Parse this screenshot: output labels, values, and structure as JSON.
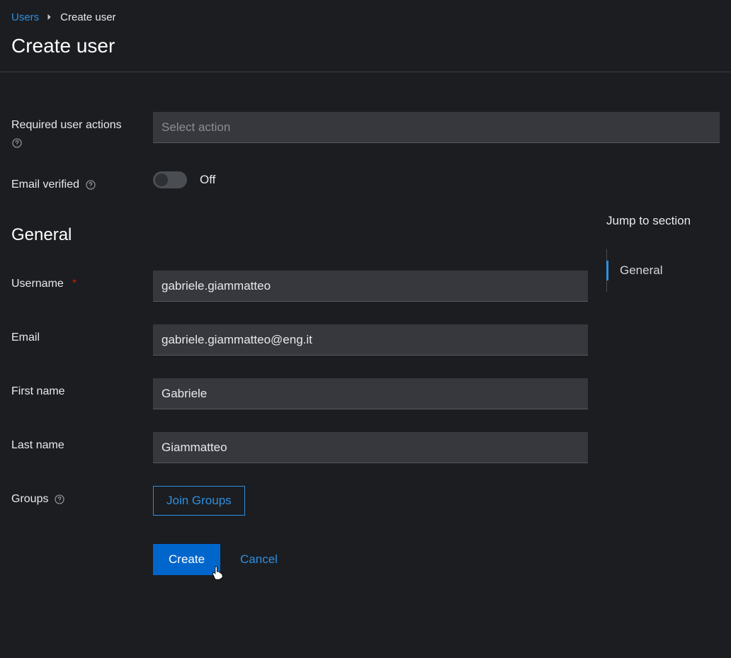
{
  "breadcrumb": {
    "users": "Users",
    "current": "Create user"
  },
  "page": {
    "title": "Create user"
  },
  "form": {
    "required_actions": {
      "label": "Required user actions",
      "placeholder": "Select action"
    },
    "email_verified": {
      "label": "Email verified",
      "state_label": "Off",
      "value": false
    },
    "section_title": "General",
    "username": {
      "label": "Username",
      "value": "gabriele.giammatteo",
      "required": true
    },
    "email": {
      "label": "Email",
      "value": "gabriele.giammatteo@eng.it"
    },
    "first_name": {
      "label": "First name",
      "value": "Gabriele"
    },
    "last_name": {
      "label": "Last name",
      "value": "Giammatteo"
    },
    "groups": {
      "label": "Groups",
      "button": "Join Groups"
    },
    "actions": {
      "create": "Create",
      "cancel": "Cancel"
    }
  },
  "jump": {
    "title": "Jump to section",
    "items": [
      "General"
    ]
  }
}
